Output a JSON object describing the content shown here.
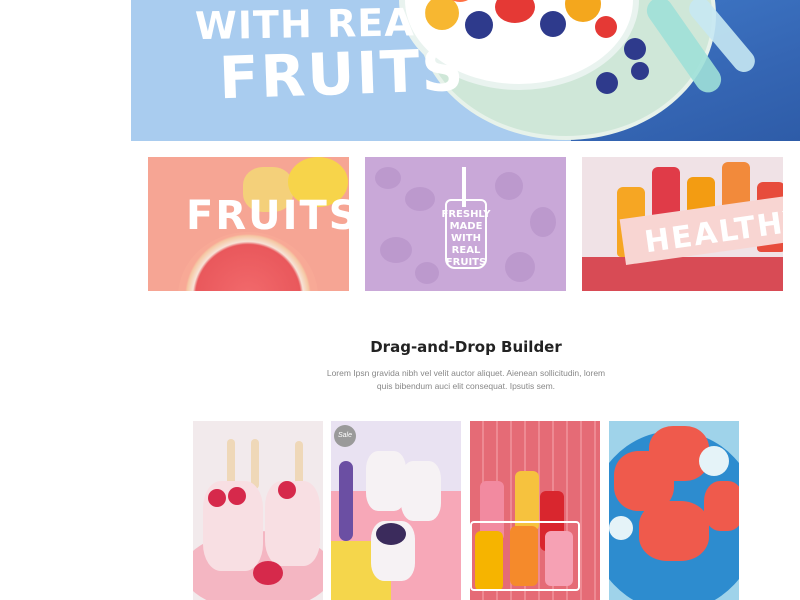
{
  "hero": {
    "line1": "WITH REAL",
    "line2": "FRUITS"
  },
  "tiles": [
    {
      "label": "FRUITS"
    },
    {
      "label": "FRESHLY MADE WITH REAL FRUITS"
    },
    {
      "label": "HEALTHY"
    }
  ],
  "section": {
    "title": "Drag-and-Drop Builder",
    "description": "Lorem Ipsn gravida nibh vel velit auctor aliquet. Aienean sollicitudin, lorem quis bibendum auci elit consequat. Ipsutis sem."
  },
  "products": [
    {
      "badge": ""
    },
    {
      "badge": "Sale"
    },
    {
      "badge": ""
    },
    {
      "badge": ""
    }
  ],
  "colors": {
    "hero_sky": "#a9ccef",
    "tile_pink": "#f6a594",
    "tile_lilac": "#c9a8d8",
    "heading": "#222222",
    "body_text": "#888888"
  }
}
